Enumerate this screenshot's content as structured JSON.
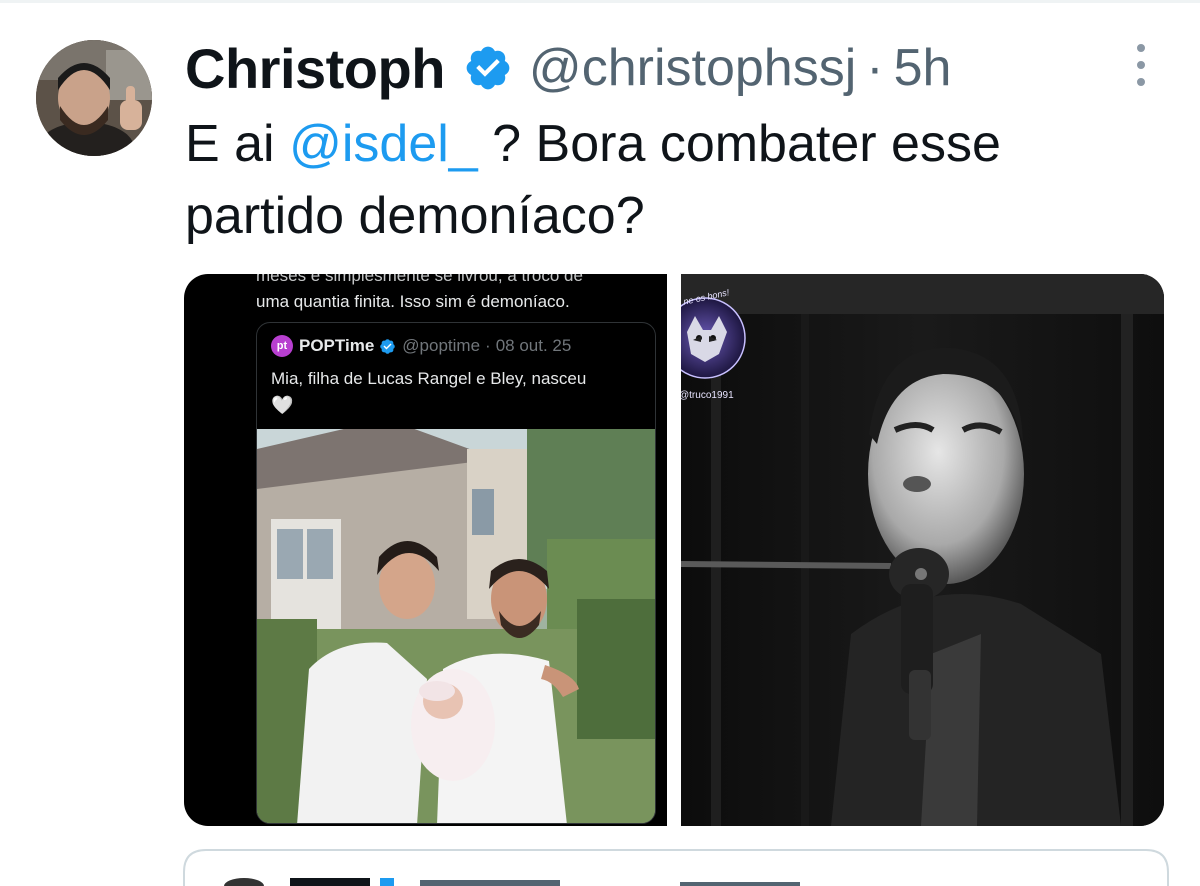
{
  "tweet": {
    "author_name": "Christoph",
    "verified": true,
    "handle": "@christophssj",
    "separator": "·",
    "time": "5h",
    "text_before": "E ai ",
    "mention": "@isdel_",
    "text_after": " ? Bora combater esse partido demoníaco?"
  },
  "media_left": {
    "cut_line": "meses e simplesmente se livrou, a troco de",
    "prev_text": "uma quantia finita. Isso sim é demoníaco.",
    "quoted": {
      "logo": "pt",
      "name": "POPTime",
      "handle": "@poptime",
      "separator": "·",
      "date": "08 out. 25",
      "text": "Mia, filha de Lucas Rangel e Bley, nasceu",
      "emoji": "🤍"
    }
  },
  "media_right": {
    "watermark_top": "ne os bons!",
    "watermark_handle": "@truco1991"
  },
  "colors": {
    "accent": "#1d9bf0",
    "text": "#0f1419",
    "secondary": "#536471"
  },
  "icons": {
    "verified": "verified-badge-icon",
    "more": "more-vertical-icon"
  }
}
